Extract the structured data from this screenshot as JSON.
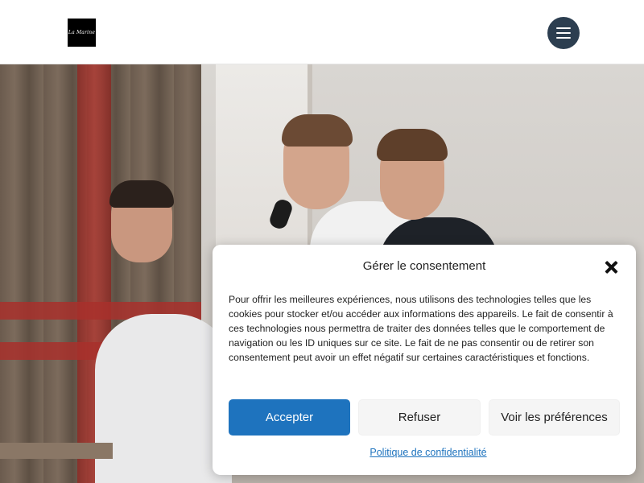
{
  "header": {
    "logo_text": "La Marine",
    "menu_icon": "hamburger-icon"
  },
  "hero": {
    "image": "photo of three young men speaking with a microphone in a room with curtains"
  },
  "consent": {
    "title": "Gérer le consentement",
    "close_icon": "close-icon",
    "text": "Pour offrir les meilleures expériences, nous utilisons des technologies telles que les cookies pour stocker et/ou accéder aux informations des appareils. Le fait de consentir à ces technologies nous permettra de traiter des données telles que le comportement de navigation ou les ID uniques sur ce site. Le fait de ne pas consentir ou de retirer son consentement peut avoir un effet négatif sur certaines caractéristiques et fonctions.",
    "accept_label": "Accepter",
    "refuse_label": "Refuser",
    "preferences_label": "Voir les préférences",
    "privacy_link": "Politique de confidentialité",
    "accent_color": "#1e73be"
  }
}
